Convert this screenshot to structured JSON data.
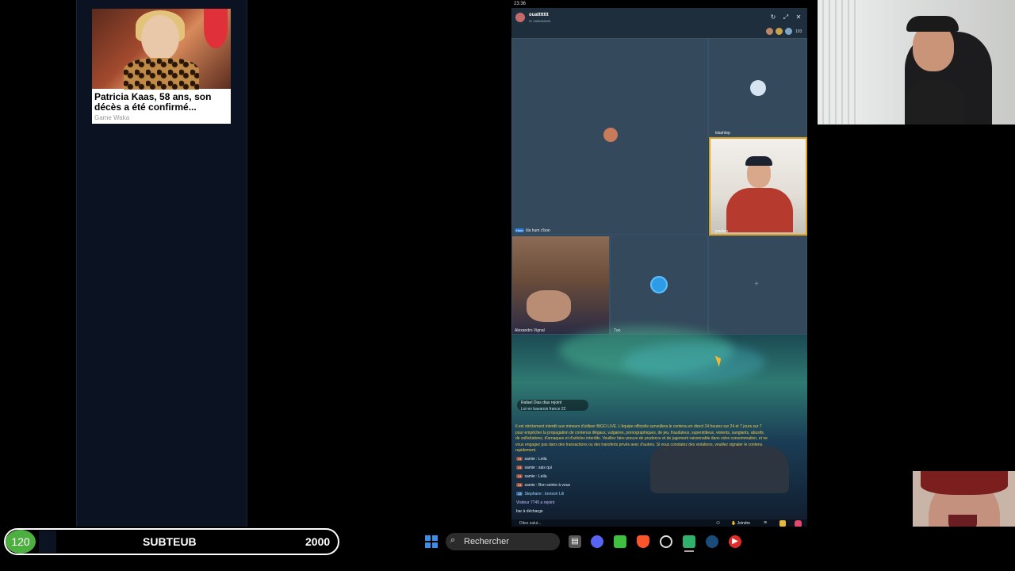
{
  "status_bar": {
    "time": "23:36"
  },
  "ad": {
    "title": "Patricia Kaas, 58 ans, son décès a été confirmé...",
    "source": "Game Waka"
  },
  "app": {
    "host_name": "ouattttttt",
    "host_sub": "ID 1586458428",
    "viewer_count": "193",
    "seats": {
      "s1_label": "lila hum c'bon",
      "s1_badge": "Host",
      "s2_label": "ldashtep",
      "s3_label": "joseleo",
      "s4_label": "Alexandro Vignal",
      "s5_label": "Tuo"
    },
    "chat": {
      "join_banner": "Rafael Dias dias rejoint",
      "join_sub": "Lot en bavarois france",
      "join_count": "22",
      "rules": "Il est strictement interdit aux mineurs d'utiliser BIGO LIVE. L'équipe officielle surveillera le contenu en direct 24 heures sur 24 et 7 jours sur 7 pour empêcher la propagation de contenus illégaux, vulgaires, pornographiques, de jeu, frauduleux, superstitieux, violents, sanglants, abusifs, de sollicitations, d'arnaques et d'articles interdits. Veuillez faire preuve de prudence et de jugement raisonnable dans votre consommation, et ne vous engagez pas dans des transactions ou des transferts privés avec d'autres. Si vous constatez des violations, veuillez signaler le contenu rapidement.",
      "messages": [
        {
          "level": "24",
          "text": "samie : Leila"
        },
        {
          "level": "24",
          "text": "samie : sais qui"
        },
        {
          "level": "24",
          "text": "samie : Leila"
        },
        {
          "level": "24",
          "text": "samie : Bon soirée à vous"
        },
        {
          "level": "13",
          "text": "Stephane : bonsoir Lili"
        }
      ],
      "system_1": "Visiteur 7745 a rejoint",
      "system_2": "bar à décharge",
      "input_placeholder": "Dites salut..."
    },
    "join_label": "Joindre"
  },
  "sub_goal": {
    "count": "120",
    "label": "SUBTEUB",
    "goal": "2000",
    "progress": 0.06
  },
  "taskbar": {
    "search_label": "Rechercher"
  }
}
